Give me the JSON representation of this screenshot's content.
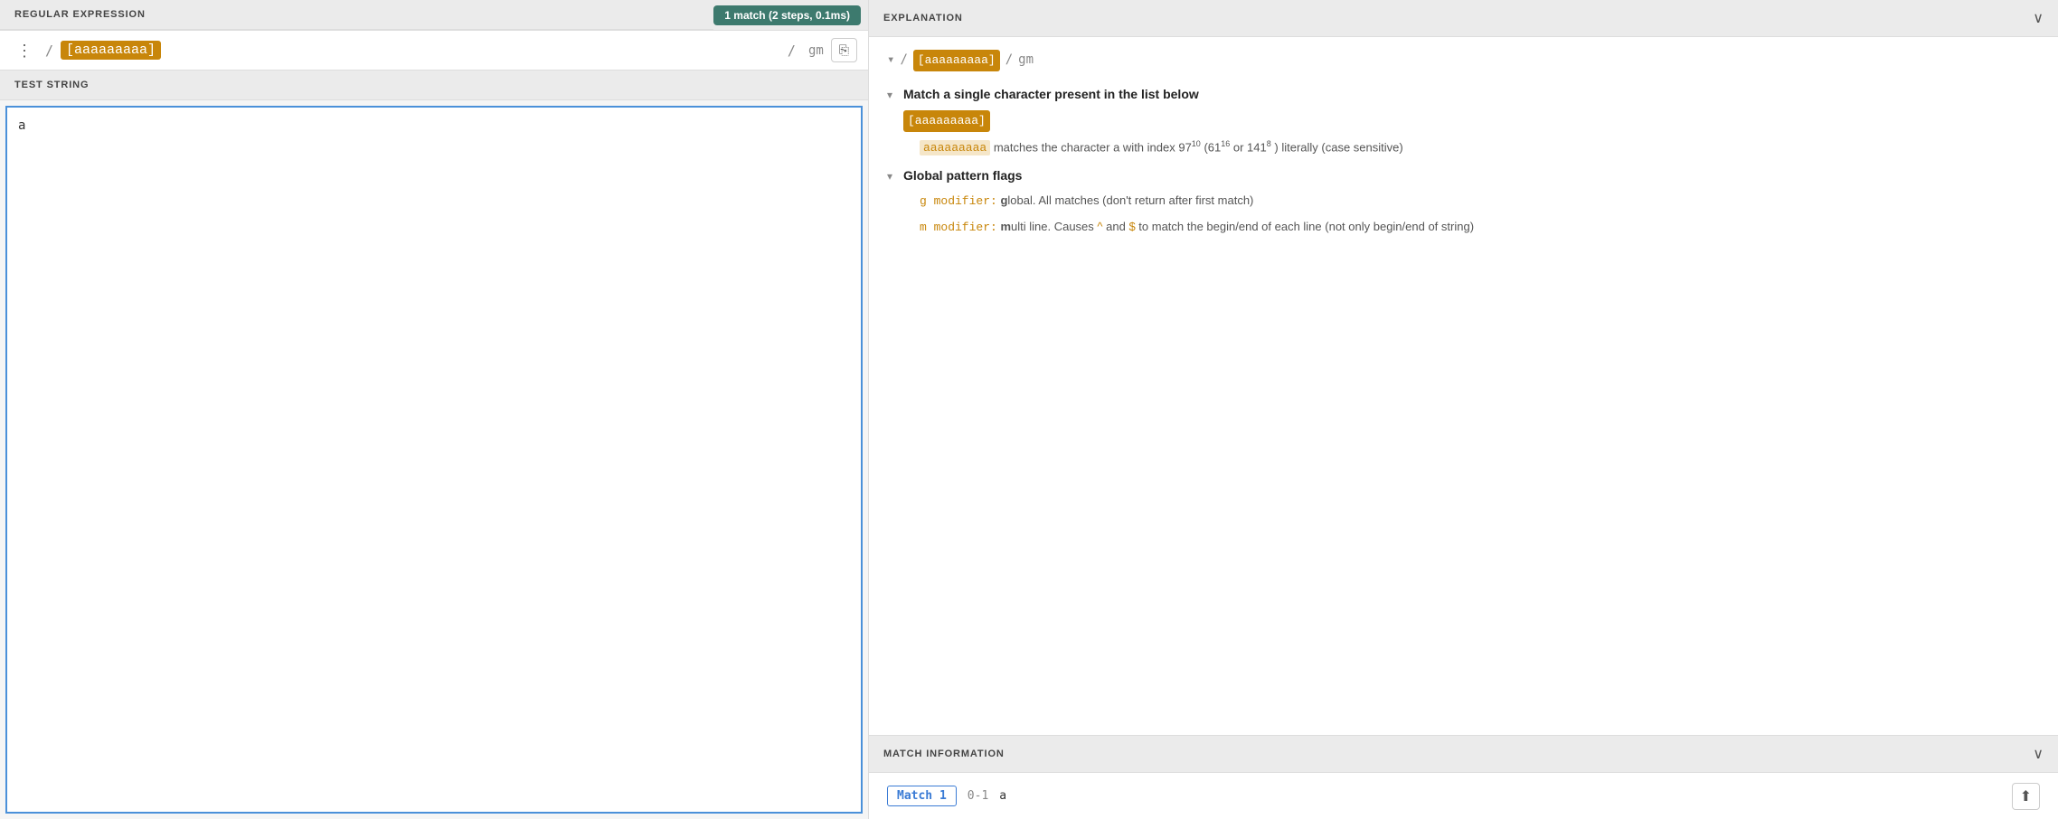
{
  "left": {
    "regex_section_label": "REGULAR EXPRESSION",
    "match_badge": "1 match (2 steps, 0.1ms)",
    "three_dot": "⋮",
    "slash": "/",
    "pattern": "[aaaaaaaaa]",
    "flags_separator": "/",
    "flags": "gm",
    "copy_icon": "⎘",
    "test_string_label": "TEST STRING",
    "test_string_value": "a"
  },
  "right": {
    "explanation_label": "EXPLANATION",
    "chevron_label": "∨",
    "regex_display": "/ [aaaaaaaaa] / gm",
    "regex_slash1": "/",
    "regex_pattern": "[aaaaaaaaa]",
    "regex_slash2": "/",
    "regex_flags": "gm",
    "tree": {
      "node1": {
        "toggle": "▾",
        "label": "Match a single character present in the list below",
        "badge": "[aaaaaaaaa]",
        "sub": {
          "highlight": "aaaaaaaaa",
          "text1": " matches the character a with index 97",
          "sup1": "10",
          "text2": " (61",
          "sup2": "16",
          "text3": " or 141",
          "sup3": "8",
          "text4": ") literally (case sensitive)"
        }
      },
      "node2": {
        "toggle": "▾",
        "label": "Global pattern flags",
        "sub1_code": "g modifier:",
        "sub1_bold": "g",
        "sub1_text": "lobal. All matches (don't return after first match)",
        "sub2_code": "m modifier:",
        "sub2_bold": "m",
        "sub2_text": "ulti line. Causes ",
        "sub2_caret": "^",
        "sub2_and": " and ",
        "sub2_dollar": "$",
        "sub2_rest": " to match the begin/end of each line (not only begin/end of string)"
      }
    },
    "match_info_label": "MATCH INFORMATION",
    "match_info_chevron": "∨",
    "match_tab": "Match 1",
    "match_range": "0-1",
    "match_value": "a",
    "share_icon": "⬆",
    "bottom_match_label": "Match"
  }
}
